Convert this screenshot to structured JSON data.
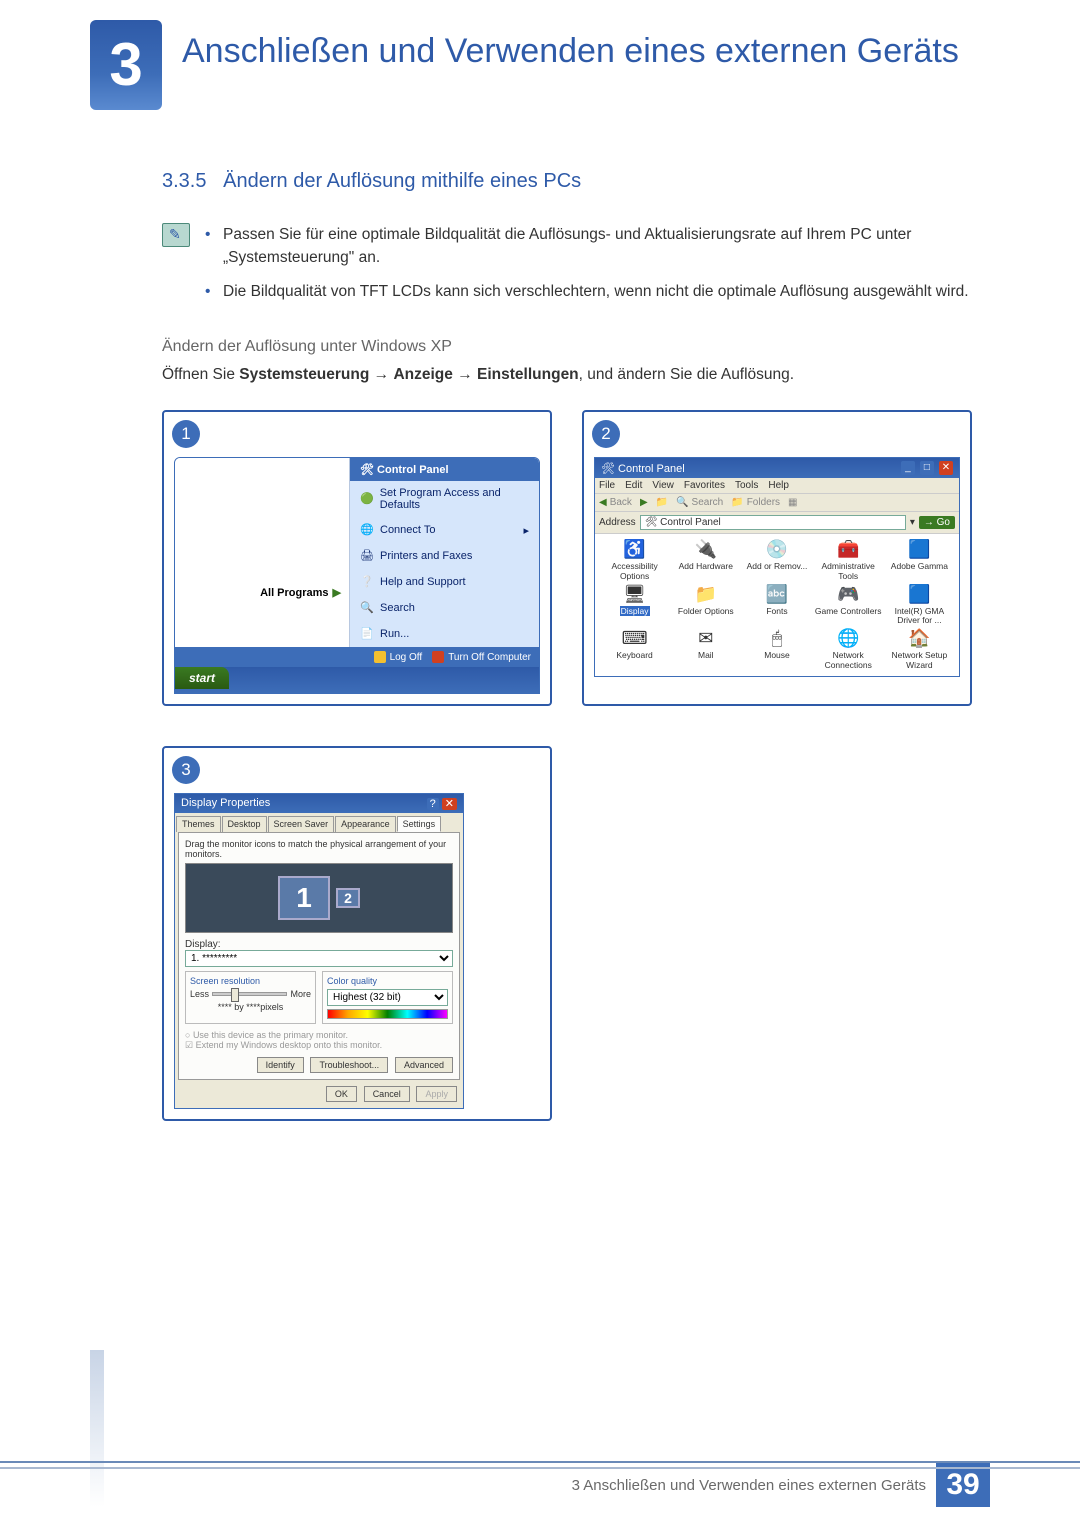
{
  "chapter": {
    "number": "3",
    "title": "Anschließen und Verwenden eines externen Geräts"
  },
  "section": {
    "number": "3.3.5",
    "title": "Ändern der Auflösung mithilfe eines PCs"
  },
  "notes": [
    "Passen Sie für eine optimale Bildqualität die Auflösungs- und Aktualisierungsrate auf Ihrem PC unter „Systemsteuerung\" an.",
    "Die Bildqualität von TFT LCDs kann sich verschlechtern, wenn nicht die optimale Auflösung ausgewählt wird."
  ],
  "subheading": "Ändern der Auflösung unter Windows XP",
  "instruction": {
    "prefix": "Öffnen Sie ",
    "path1": "Systemsteuerung",
    "arrow": " → ",
    "path2": "Anzeige",
    "path3": "Einstellungen",
    "suffix": ", und ändern Sie die Auflösung."
  },
  "shot1": {
    "badge": "1",
    "header": "Control Panel",
    "items": [
      "Set Program Access and Defaults",
      "Connect To",
      "Printers and Faxes",
      "Help and Support",
      "Search",
      "Run..."
    ],
    "allPrograms": "All Programs",
    "logOff": "Log Off",
    "turnOff": "Turn Off Computer",
    "start": "start"
  },
  "shot2": {
    "badge": "2",
    "title": "Control Panel",
    "menus": [
      "File",
      "Edit",
      "View",
      "Favorites",
      "Tools",
      "Help"
    ],
    "back": "Back",
    "search": "Search",
    "folders": "Folders",
    "addressLabel": "Address",
    "addressValue": "Control Panel",
    "go": "Go",
    "icons": [
      "Accessibility Options",
      "Add Hardware",
      "Add or Remov...",
      "Administrative Tools",
      "Adobe Gamma",
      "Display",
      "Folder Options",
      "Fonts",
      "Game Controllers",
      "Intel(R) GMA Driver for ...",
      "Keyboard",
      "Mail",
      "Mouse",
      "Network Connections",
      "Network Setup Wizard"
    ]
  },
  "shot3": {
    "badge": "3",
    "title": "Display Properties",
    "tabs": [
      "Themes",
      "Desktop",
      "Screen Saver",
      "Appearance",
      "Settings"
    ],
    "instr": "Drag the monitor icons to match the physical arrangement of your monitors.",
    "mon1": "1",
    "mon2": "2",
    "displayLabel": "Display:",
    "displaySel": "1. *********",
    "resHdr": "Screen resolution",
    "less": "Less",
    "more": "More",
    "resVal": "**** by ****pixels",
    "colHdr": "Color quality",
    "colSel": "Highest (32 bit)",
    "chk1": "Use this device as the primary monitor.",
    "chk2": "Extend my Windows desktop onto this monitor.",
    "btnIdentify": "Identify",
    "btnTrouble": "Troubleshoot...",
    "btnAdv": "Advanced",
    "btnOK": "OK",
    "btnCancel": "Cancel",
    "btnApply": "Apply"
  },
  "footer": {
    "text": "3 Anschließen und Verwenden eines externen Geräts",
    "page": "39"
  }
}
